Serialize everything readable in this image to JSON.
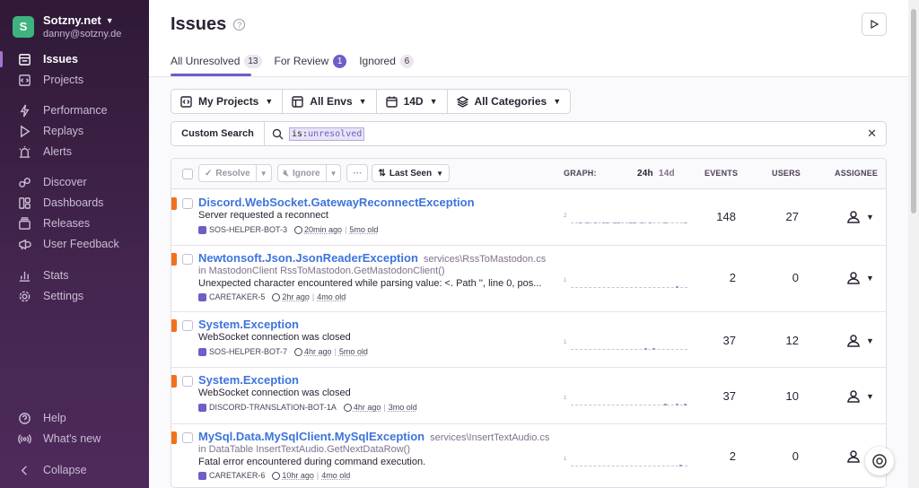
{
  "org": {
    "initial": "S",
    "name": "Sotzny.net",
    "email": "danny@sotzny.de"
  },
  "nav": {
    "issues": "Issues",
    "projects": "Projects",
    "performance": "Performance",
    "replays": "Replays",
    "alerts": "Alerts",
    "discover": "Discover",
    "dashboards": "Dashboards",
    "releases": "Releases",
    "user_feedback": "User Feedback",
    "stats": "Stats",
    "settings": "Settings",
    "help": "Help",
    "whats_new": "What's new",
    "collapse": "Collapse"
  },
  "header": {
    "title": "Issues",
    "help_glyph": "?"
  },
  "tabs": [
    {
      "label": "All Unresolved",
      "count": "13"
    },
    {
      "label": "For Review",
      "count": "1"
    },
    {
      "label": "Ignored",
      "count": "6"
    }
  ],
  "filters": {
    "projects": "My Projects",
    "envs": "All Envs",
    "period": "14D",
    "categories": "All Categories"
  },
  "search": {
    "button": "Custom Search",
    "token_key": "is:",
    "token_value": "unresolved"
  },
  "table_head": {
    "resolve": "Resolve",
    "ignore": "Ignore",
    "more": "···",
    "sort": "Last Seen",
    "graph": "GRAPH:",
    "range_24h": "24h",
    "range_14d": "14d",
    "events": "EVENTS",
    "users": "USERS",
    "assignee": "ASSIGNEE"
  },
  "issues": [
    {
      "title": "Discord.WebSocket.GatewayReconnectException",
      "location": "",
      "culprit": "",
      "message": "Server requested a reconnect",
      "project": "SOS-HELPER-BOT-3",
      "last_seen": "20min ago",
      "first_seen": "5mo old",
      "events": "148",
      "users": "27",
      "graph_max": "2",
      "graph": [
        0,
        0,
        0.5,
        0,
        0.5,
        0,
        0.5,
        0,
        0.5,
        0.5,
        0,
        0.5,
        0.5,
        0,
        0,
        0.5,
        0.5,
        0,
        0.5,
        0,
        0.5,
        0,
        0,
        0,
        0.5,
        0,
        0,
        0,
        0,
        0.5
      ]
    },
    {
      "title": "Newtonsoft.Json.JsonReaderException",
      "location": "services\\RssToMastodon.cs",
      "culprit": "in MastodonClient RssToMastodon.GetMastodonClient()",
      "message": "Unexpected character encountered while parsing value: <. Path '', line 0, pos...",
      "project": "CARETAKER-5",
      "last_seen": "2hr ago",
      "first_seen": "4mo old",
      "events": "2",
      "users": "0",
      "graph_max": "1",
      "graph": [
        0,
        0,
        0,
        0,
        0,
        0,
        0,
        0,
        0,
        0,
        0,
        0,
        0,
        0,
        0,
        0,
        0,
        0,
        0,
        0,
        0,
        0,
        0,
        0,
        0,
        0,
        0,
        1,
        0,
        0
      ]
    },
    {
      "title": "System.Exception",
      "location": "",
      "culprit": "",
      "message": "WebSocket connection was closed",
      "project": "SOS-HELPER-BOT-7",
      "last_seen": "4hr ago",
      "first_seen": "5mo old",
      "events": "37",
      "users": "12",
      "graph_max": "1",
      "graph": [
        0,
        0,
        0,
        0,
        0,
        0,
        0,
        0,
        0,
        0,
        0,
        0,
        0,
        0,
        0,
        0,
        0,
        0,
        0,
        1,
        0,
        1,
        0,
        0,
        0,
        0,
        0,
        0,
        0,
        0
      ]
    },
    {
      "title": "System.Exception",
      "location": "",
      "culprit": "",
      "message": "WebSocket connection was closed",
      "project": "DISCORD-TRANSLATION-BOT-1A",
      "last_seen": "4hr ago",
      "first_seen": "3mo old",
      "events": "37",
      "users": "10",
      "graph_max": "1",
      "graph": [
        0,
        0,
        0,
        0,
        0,
        0,
        0,
        0,
        0,
        0,
        0,
        0,
        0,
        0,
        0,
        0,
        0,
        0,
        0,
        0,
        0,
        0,
        0,
        0,
        1,
        0,
        0,
        1,
        0,
        1
      ]
    },
    {
      "title": "MySql.Data.MySqlClient.MySqlException",
      "location": "services\\InsertTextAudio.cs",
      "culprit": "in DataTable InsertTextAudio.GetNextDataRow()",
      "message": "Fatal error encountered during command execution.",
      "project": "CARETAKER-6",
      "last_seen": "10hr ago",
      "first_seen": "4mo old",
      "events": "2",
      "users": "0",
      "graph_max": "1",
      "graph": [
        0,
        0,
        0,
        0,
        0,
        0,
        0,
        0,
        0,
        0,
        0,
        0,
        0,
        0,
        0,
        0,
        0,
        0,
        0,
        0,
        0,
        0,
        0,
        0,
        0,
        0,
        0,
        0,
        1,
        0
      ]
    }
  ]
}
